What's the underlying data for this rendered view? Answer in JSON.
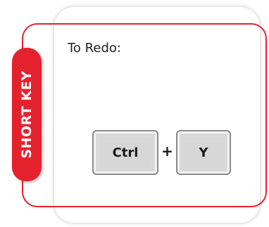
{
  "label": {
    "side_tab": "SHORT KEY"
  },
  "content": {
    "heading": "To Redo:",
    "keys": [
      "Ctrl",
      "Y"
    ],
    "separator": "+"
  },
  "colors": {
    "accent_red": "#e4222e",
    "key_fill": "#d7d7d7",
    "key_border": "#8a8a8a",
    "text": "#222222"
  }
}
